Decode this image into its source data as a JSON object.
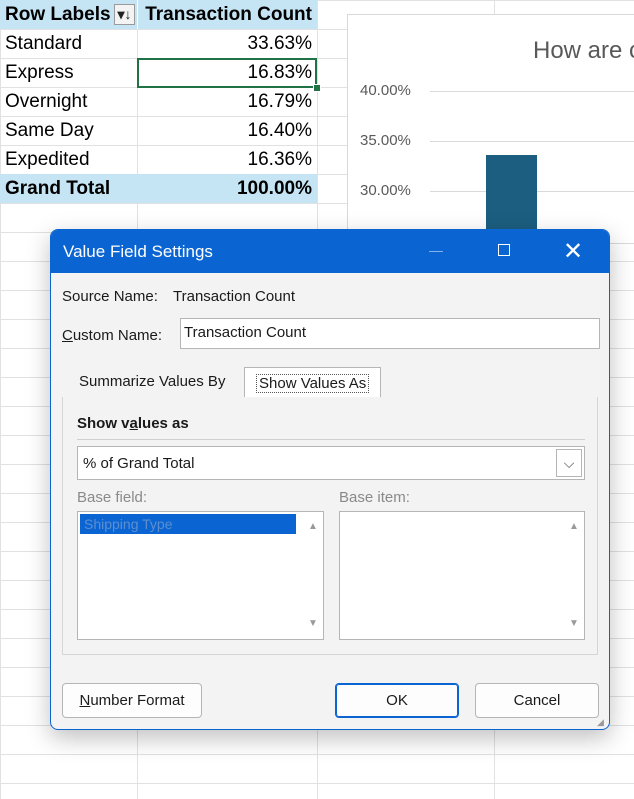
{
  "pivot": {
    "header": {
      "row_labels": "Row Labels",
      "filter_icon": "sort-filter-icon",
      "value_label": "Transaction Count"
    },
    "rows": [
      {
        "label": "Standard",
        "value": "33.63%"
      },
      {
        "label": "Express",
        "value": "16.83%"
      },
      {
        "label": "Overnight",
        "value": "16.79%"
      },
      {
        "label": "Same Day",
        "value": "16.40%"
      },
      {
        "label": "Expedited",
        "value": "16.36%"
      }
    ],
    "total": {
      "label": "Grand Total",
      "value": "100.00%"
    }
  },
  "chart": {
    "title_fragment": "How are c",
    "yticks": [
      "40.00%",
      "35.00%",
      "30.00%"
    ]
  },
  "chart_data": {
    "type": "bar",
    "title": "How are c",
    "ylim": [
      25,
      42
    ],
    "yticks": [
      "40.00%",
      "35.00%",
      "30.00%"
    ],
    "categories": [
      "Standard"
    ],
    "values": [
      33.63
    ],
    "color": "#1b5e80",
    "grid": true
  },
  "dialog": {
    "title": "Value Field Settings",
    "source_name_label": "Source Name:",
    "source_name_value": "Transaction Count",
    "custom_name_label_prefix": "C",
    "custom_name_label_rest": "ustom Name:",
    "custom_name_value": "Transaction Count",
    "tabs": {
      "summarize": "Summarize Values By",
      "show_as": "Show Values As"
    },
    "show_values_as_label_prefix": "Show v",
    "show_values_as_label_u": "a",
    "show_values_as_label_rest": "lues as",
    "show_values_as_value": "% of Grand Total",
    "base_field_label": "Base field:",
    "base_item_label": "Base item:",
    "base_field_items": [
      "Shipping Type"
    ],
    "number_format_prefix": "N",
    "number_format_rest": "umber Format",
    "ok_label": "OK",
    "cancel_label": "Cancel",
    "accent_color": "#0a64d2"
  }
}
